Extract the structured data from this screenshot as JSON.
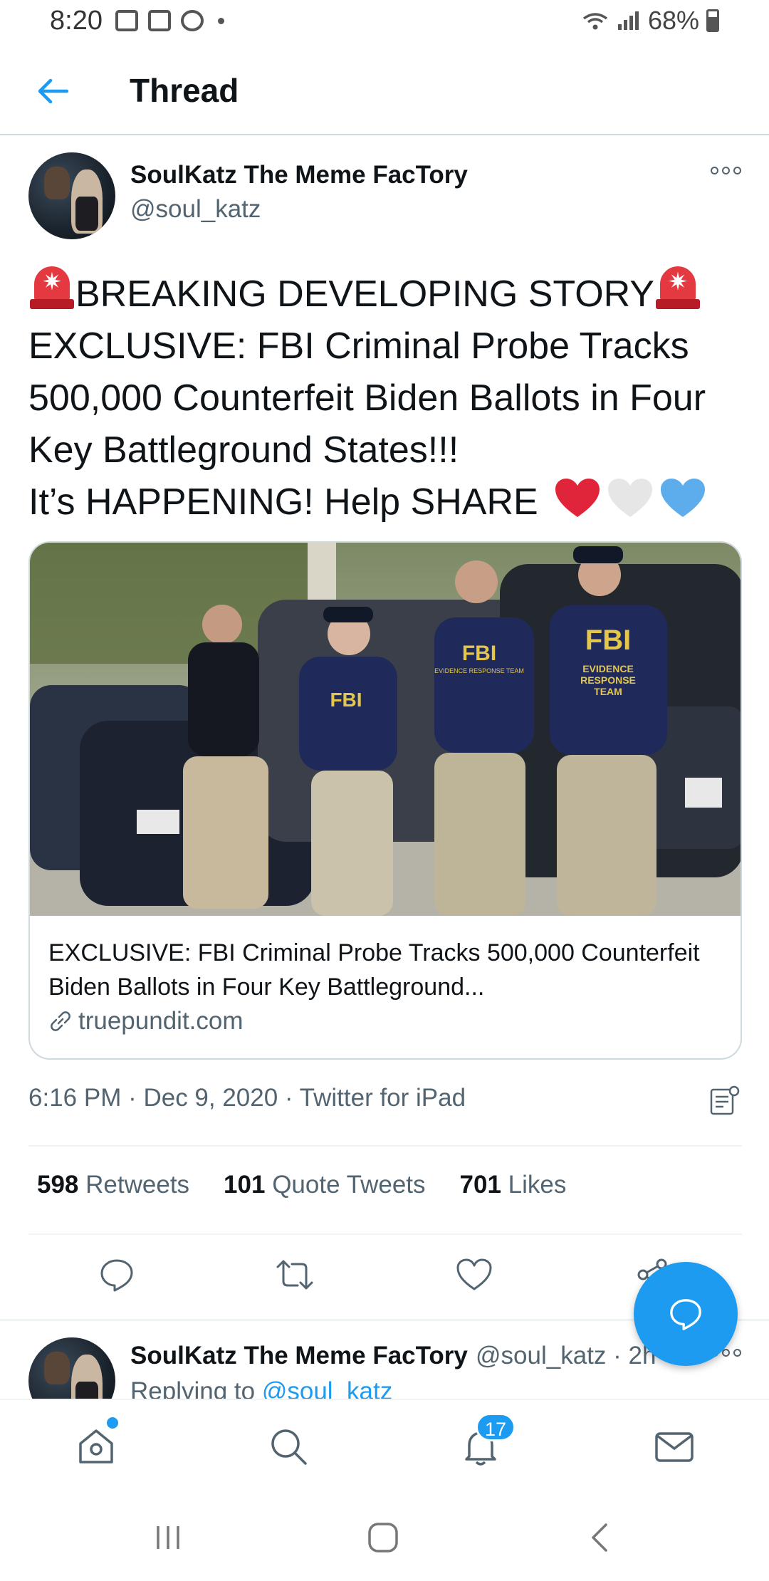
{
  "status_bar": {
    "time": "8:20",
    "battery": "68%"
  },
  "header": {
    "title": "Thread"
  },
  "tweet": {
    "author_name": "SoulKatz The Meme FacTory",
    "author_handle": "@soul_katz",
    "text_lines": [
      "BREAKING DEVELOPING STORY",
      "EXCLUSIVE: FBI Criminal Probe Tracks",
      "500,000 Counterfeit Biden Ballots in Four",
      "Key Battleground States!!!",
      "It’s HAPPENING! Help SHARE"
    ],
    "emoji": {
      "siren": "police-car-light",
      "hearts": [
        "red-heart",
        "white-heart",
        "blue-heart"
      ]
    },
    "card": {
      "title": "EXCLUSIVE: FBI Criminal Probe Tracks 500,000 Counterfeit Biden Ballots in Four Key Battleground...",
      "domain": "truepundit.com",
      "image_text": {
        "shirt_large": "FBI",
        "shirt_small": "EVIDENCE RESPONSE TEAM",
        "shirt_lines": [
          "EVIDENCE",
          "RESPONSE",
          "TEAM"
        ]
      }
    },
    "meta": "6:16 PM · Dec 9, 2020 · Twitter for iPad",
    "stats": {
      "retweets_count": "598",
      "retweets_label": "Retweets",
      "quotes_count": "101",
      "quotes_label": "Quote Tweets",
      "likes_count": "701",
      "likes_label": "Likes"
    }
  },
  "reply": {
    "author_name": "SoulKatz The Meme FacTory",
    "handle_time": "@soul_katz · 2h",
    "replying_prefix": "Replying to ",
    "replying_to": "@soul_katz"
  },
  "bottom_nav": {
    "notifications_badge": "17"
  },
  "colors": {
    "accent": "#1d9bf0",
    "text": "#0f1419",
    "secondary": "#536471",
    "border": "#cfd9de"
  }
}
